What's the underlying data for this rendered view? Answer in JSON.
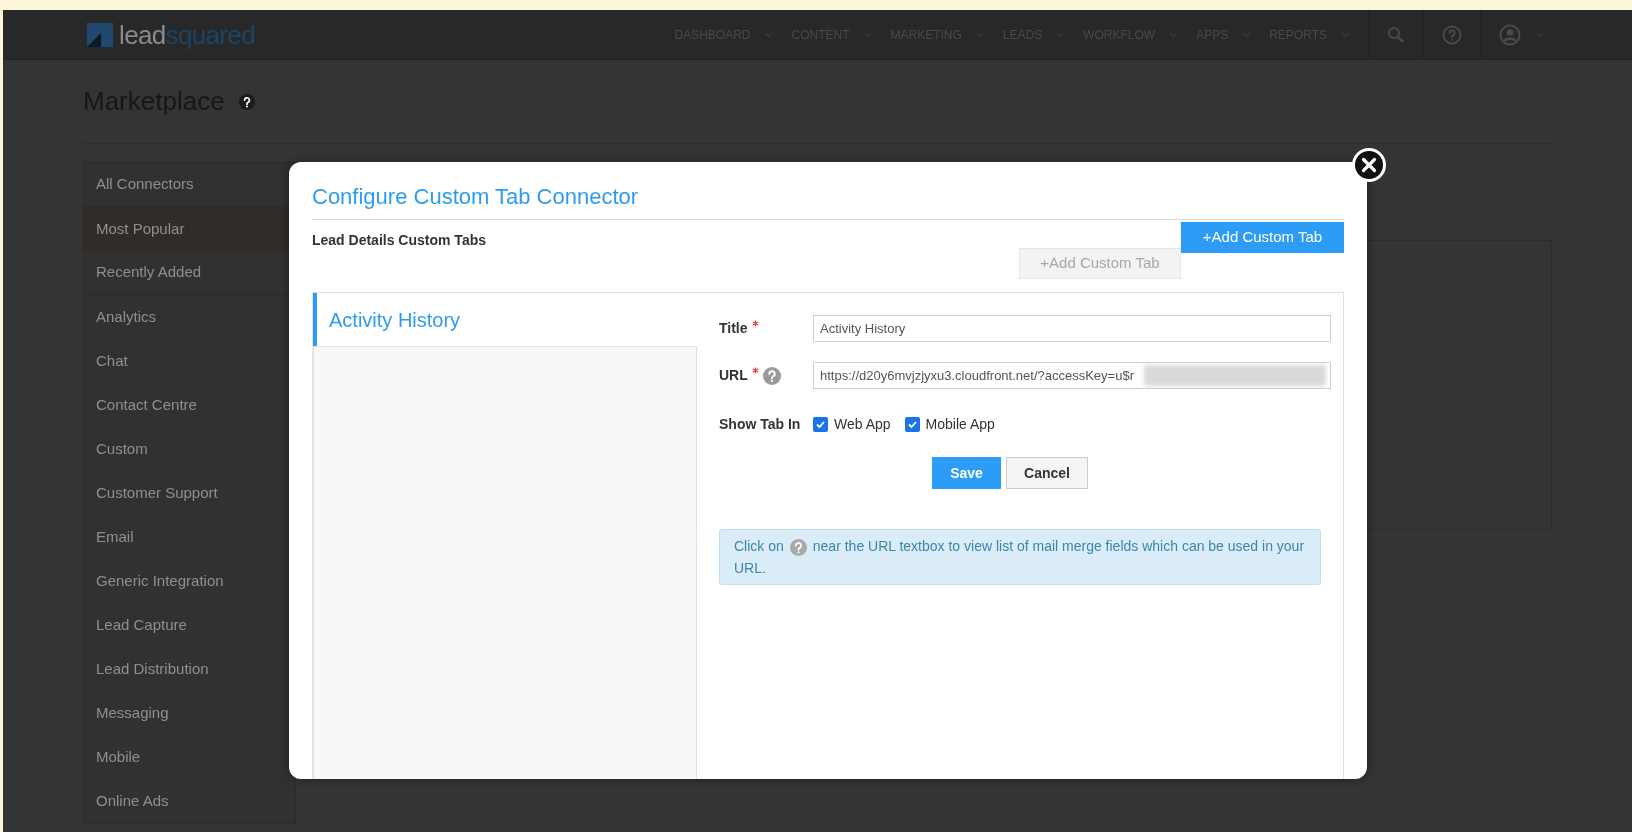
{
  "logo": {
    "parts": [
      "lead",
      "squared"
    ]
  },
  "nav": {
    "items": [
      "DASHBOARD",
      "CONTENT",
      "MARKETING",
      "LEADS",
      "WORKFLOW",
      "APPS",
      "REPORTS"
    ]
  },
  "page": {
    "title": "Marketplace"
  },
  "sidebar": {
    "items": [
      {
        "label": "All Connectors",
        "kind": "filter",
        "selected": false
      },
      {
        "label": "Most Popular",
        "kind": "filter",
        "selected": true
      },
      {
        "label": "Recently Added",
        "kind": "filter",
        "selected": false
      },
      {
        "label": "Analytics",
        "kind": "category",
        "selected": false
      },
      {
        "label": "Chat",
        "kind": "category",
        "selected": false
      },
      {
        "label": "Contact Centre",
        "kind": "category",
        "selected": false
      },
      {
        "label": "Custom",
        "kind": "category",
        "selected": false
      },
      {
        "label": "Customer Support",
        "kind": "category",
        "selected": false
      },
      {
        "label": "Email",
        "kind": "category",
        "selected": false
      },
      {
        "label": "Generic Integration",
        "kind": "category",
        "selected": false
      },
      {
        "label": "Lead Capture",
        "kind": "category",
        "selected": false
      },
      {
        "label": "Lead Distribution",
        "kind": "category",
        "selected": false
      },
      {
        "label": "Messaging",
        "kind": "category",
        "selected": false
      },
      {
        "label": "Mobile",
        "kind": "category",
        "selected": false
      },
      {
        "label": "Online Ads",
        "kind": "category",
        "selected": false
      }
    ]
  },
  "modal": {
    "title": "Configure Custom Tab Connector",
    "section_title": "Lead Details Custom Tabs",
    "add_button": "+Add Custom Tab",
    "ghost_button": {
      "label": "+Add Custom Tab",
      "disabled": true
    },
    "tabs": [
      {
        "label": "Activity History",
        "selected": true
      }
    ],
    "form": {
      "fields": [
        {
          "label": "Title",
          "required": true,
          "help": false,
          "value": "Activity History",
          "redacted": false
        },
        {
          "label": "URL",
          "required": true,
          "help": true,
          "value": "https://d20y6mvjzjyxu3.cloudfront.net/?accessKey=u$r",
          "redacted": true
        }
      ],
      "show_tab_in": {
        "label": "Show Tab In",
        "options": [
          {
            "label": "Web App",
            "checked": true
          },
          {
            "label": "Mobile App",
            "checked": true
          }
        ]
      },
      "save": "Save",
      "cancel": "Cancel"
    },
    "info": {
      "before": "Click on",
      "after": "near the URL textbox to view list of mail merge fields which can be used in your URL."
    }
  }
}
